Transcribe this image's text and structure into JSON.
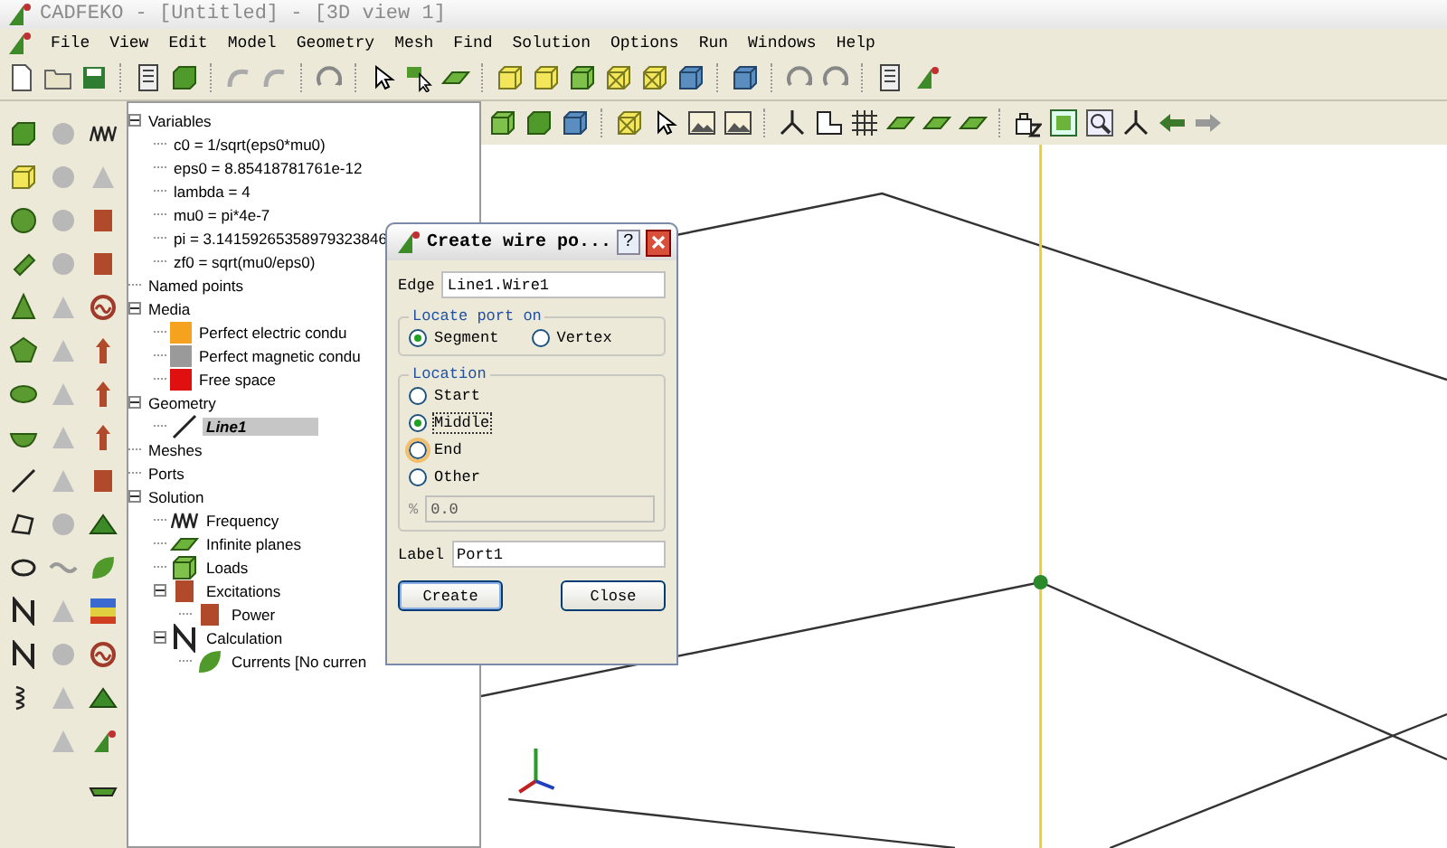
{
  "window": {
    "title": "CADFEKO - [Untitled] - [3D view 1]"
  },
  "menu": [
    "File",
    "View",
    "Edit",
    "Model",
    "Geometry",
    "Mesh",
    "Find",
    "Solution",
    "Options",
    "Run",
    "Windows",
    "Help"
  ],
  "tree": [
    {
      "label": "Variables",
      "selected": false,
      "expanded": true,
      "children": [
        {
          "label": "c0 = 1/sqrt(eps0*mu0)",
          "selected": false
        },
        {
          "label": "eps0 = 8.85418781761e-12",
          "selected": false
        },
        {
          "label": "lambda = 4",
          "selected": false
        },
        {
          "label": "mu0 = pi*4e-7",
          "selected": false
        },
        {
          "label": "pi = 3.14159265358979323846",
          "selected": false
        },
        {
          "label": "zf0 = sqrt(mu0/eps0)",
          "selected": false
        }
      ]
    },
    {
      "label": "Named points",
      "selected": false
    },
    {
      "label": "Media",
      "selected": false,
      "expanded": true,
      "children": [
        {
          "label": "Perfect electric condu",
          "selected": false,
          "kind": "medium",
          "color": "#f5a21e"
        },
        {
          "label": "Perfect magnetic condu",
          "selected": false,
          "kind": "medium",
          "color": "#9a9a9a"
        },
        {
          "label": "Free space",
          "selected": false,
          "kind": "medium",
          "color": "#e01010"
        }
      ]
    },
    {
      "label": "Geometry",
      "selected": false,
      "expanded": true,
      "children": [
        {
          "label": "Line1",
          "selected": true,
          "kind": "wire"
        }
      ]
    },
    {
      "label": "Meshes",
      "selected": false
    },
    {
      "label": "Ports",
      "selected": false
    },
    {
      "label": "Solution",
      "selected": false,
      "expanded": true,
      "children": [
        {
          "label": "Frequency",
          "selected": false,
          "kind": "frequency"
        },
        {
          "label": "Infinite planes",
          "selected": false,
          "kind": "plane"
        },
        {
          "label": "Loads",
          "selected": false,
          "kind": "load"
        },
        {
          "label": "Excitations",
          "selected": false,
          "expanded": true,
          "kind": "excitation",
          "children": [
            {
              "label": "Power",
              "selected": false,
              "kind": "power"
            }
          ]
        },
        {
          "label": "Calculation",
          "selected": false,
          "expanded": true,
          "kind": "calculation",
          "children": [
            {
              "label": "Currents [No curren",
              "selected": false,
              "kind": "currents"
            }
          ]
        }
      ]
    }
  ],
  "dialog": {
    "title": "Create wire po...",
    "help": "?",
    "edge": {
      "label": "Edge",
      "value": "Line1.Wire1"
    },
    "locate": {
      "title": "Locate port on",
      "options": [
        {
          "label": "Segment",
          "selected": true
        },
        {
          "label": "Vertex",
          "selected": false
        }
      ]
    },
    "location": {
      "title": "Location",
      "options": [
        {
          "label": "Start",
          "selected": false,
          "hovered": false,
          "focused": false
        },
        {
          "label": "Middle",
          "selected": true,
          "hovered": false,
          "focused": true
        },
        {
          "label": "End",
          "selected": false,
          "hovered": true,
          "focused": false
        },
        {
          "label": "Other",
          "selected": false,
          "hovered": false,
          "focused": false
        }
      ],
      "percent": {
        "label": "%",
        "value": "0.0",
        "disabled": true
      }
    },
    "label_field": {
      "label": "Label",
      "value": "Port1"
    },
    "buttons": [
      {
        "label": "Create",
        "default": true
      },
      {
        "label": "Close",
        "default": false
      }
    ]
  }
}
